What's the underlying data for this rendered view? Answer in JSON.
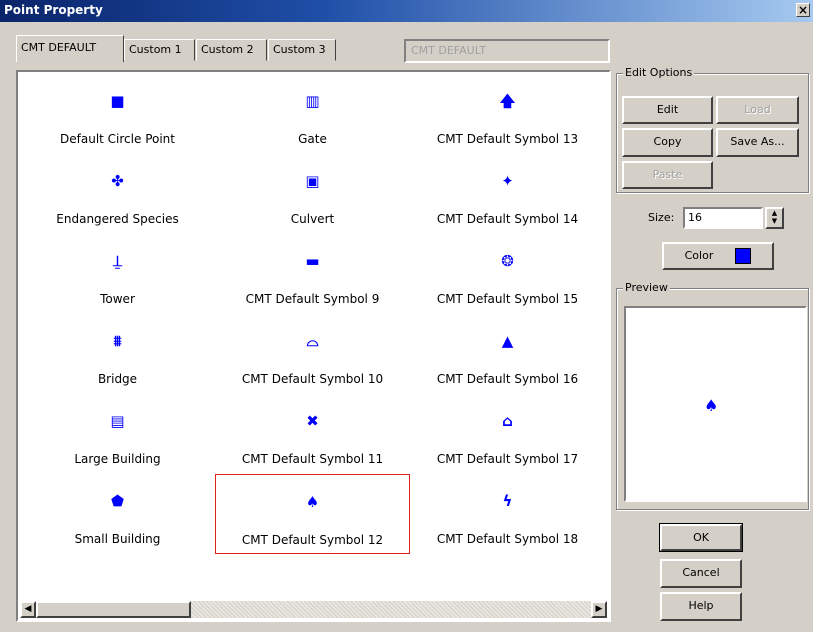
{
  "window": {
    "title": "Point Property",
    "close_label": "×"
  },
  "tabs": [
    {
      "label": "CMT DEFAULT",
      "active": true
    },
    {
      "label": "Custom 1",
      "active": false
    },
    {
      "label": "Custom 2",
      "active": false
    },
    {
      "label": "Custom 3",
      "active": false
    }
  ],
  "library_name_value": "CMT DEFAULT",
  "symbols": [
    {
      "label": "Default Circle Point",
      "icon": "circle-point-icon",
      "glyph": "■"
    },
    {
      "label": "Gate",
      "icon": "gate-icon",
      "glyph": "▥"
    },
    {
      "label": "CMT Default Symbol 13",
      "icon": "up-arrow-icon",
      "glyph": "🡅"
    },
    {
      "label": "Endangered Species",
      "icon": "bird-icon",
      "glyph": "✤"
    },
    {
      "label": "Culvert",
      "icon": "culvert-icon",
      "glyph": "▣"
    },
    {
      "label": "CMT Default Symbol 14",
      "icon": "star-icon",
      "glyph": "✦"
    },
    {
      "label": "Tower",
      "icon": "tower-icon",
      "glyph": "⍊"
    },
    {
      "label": "CMT Default Symbol 9",
      "icon": "dome-icon",
      "glyph": "▬"
    },
    {
      "label": "CMT Default Symbol 15",
      "icon": "gear-icon",
      "glyph": "❂"
    },
    {
      "label": "Bridge",
      "icon": "bridge-icon",
      "glyph": "⩩"
    },
    {
      "label": "CMT Default Symbol 10",
      "icon": "cloud-outline-icon",
      "glyph": "⌓"
    },
    {
      "label": "CMT Default Symbol 16",
      "icon": "mountain-icon",
      "glyph": "▲"
    },
    {
      "label": "Large Building",
      "icon": "large-building-icon",
      "glyph": "▤"
    },
    {
      "label": "CMT Default Symbol 11",
      "icon": "x-icon",
      "glyph": "✖"
    },
    {
      "label": "CMT Default Symbol 17",
      "icon": "house-icon",
      "glyph": "⌂"
    },
    {
      "label": "Small Building",
      "icon": "small-building-icon",
      "glyph": "⬟"
    },
    {
      "label": "CMT Default Symbol 12",
      "icon": "tree-icon",
      "glyph": "♠",
      "selected": true
    },
    {
      "label": "CMT Default Symbol 18",
      "icon": "lightning-icon",
      "glyph": "ϟ"
    }
  ],
  "scrollbar": {
    "left_arrow": "◀",
    "right_arrow": "▶"
  },
  "edit_options": {
    "legend": "Edit Options",
    "edit_label": "Edit",
    "load_label": "Load",
    "copy_label": "Copy",
    "save_as_label": "Save As...",
    "paste_label": "Paste"
  },
  "size": {
    "label": "Size:",
    "value": "16",
    "up": "▲",
    "down": "▼"
  },
  "color": {
    "label": "Color",
    "value": "#0000ff"
  },
  "preview": {
    "legend": "Preview",
    "glyph": "♠"
  },
  "buttons": {
    "ok": "OK",
    "cancel": "Cancel",
    "help": "Help"
  }
}
